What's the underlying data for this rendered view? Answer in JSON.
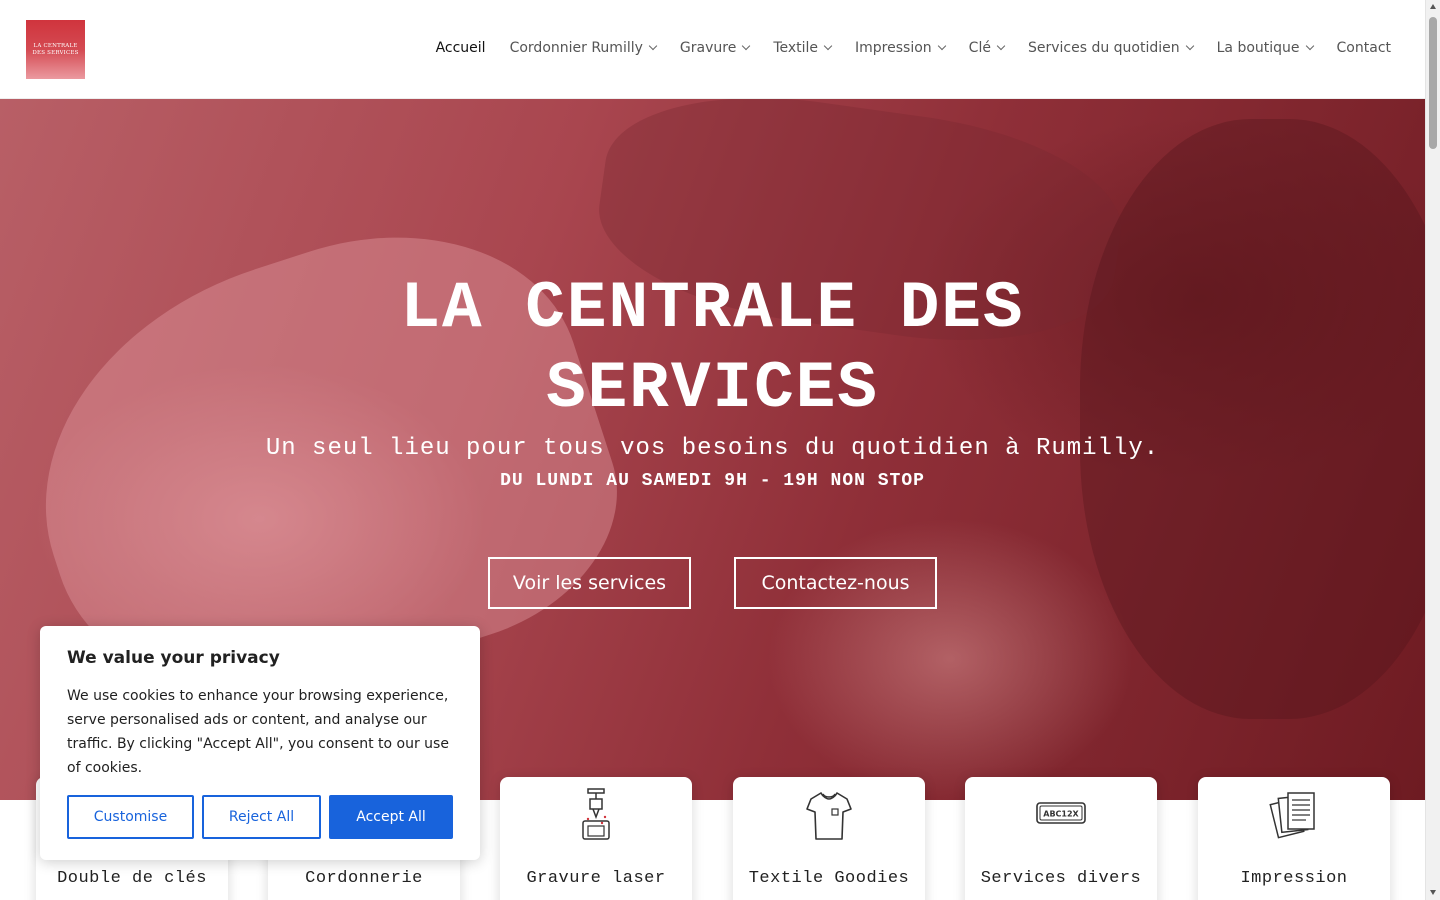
{
  "header": {
    "logo_line1": "LA CENTRALE",
    "logo_line2": "DES SERVICES",
    "nav": [
      {
        "label": "Accueil",
        "dropdown": false
      },
      {
        "label": "Cordonnier Rumilly",
        "dropdown": true
      },
      {
        "label": "Gravure",
        "dropdown": true
      },
      {
        "label": "Textile",
        "dropdown": true
      },
      {
        "label": "Impression",
        "dropdown": true
      },
      {
        "label": "Clé",
        "dropdown": true
      },
      {
        "label": "Services du quotidien",
        "dropdown": true
      },
      {
        "label": "La boutique",
        "dropdown": true
      },
      {
        "label": "Contact",
        "dropdown": false
      }
    ]
  },
  "hero": {
    "title_line1": "LA CENTRALE DES",
    "title_line2": "SERVICES",
    "subtitle": "Un seul lieu pour tous vos besoins du quotidien à Rumilly.",
    "hours": "DU LUNDI AU SAMEDI 9H - 19H NON STOP",
    "button_services": "Voir les services",
    "button_contact": "Contactez-nous"
  },
  "services": [
    {
      "label": "Double de clés",
      "icon": "key-icon"
    },
    {
      "label": "Cordonnerie",
      "icon": "shoe-icon"
    },
    {
      "label": "Gravure laser",
      "icon": "laser-engraver-icon"
    },
    {
      "label": "Textile Goodies",
      "icon": "tshirt-icon"
    },
    {
      "label": "Services divers",
      "icon": "license-plate-icon"
    },
    {
      "label": "Impression",
      "icon": "documents-icon"
    }
  ],
  "plate_text": "ABC12X",
  "cookie": {
    "title": "We value your privacy",
    "text": "We use cookies to enhance your browsing experience, serve personalised ads or content, and analyse our traffic. By clicking \"Accept All\", you consent to our use of cookies.",
    "customise": "Customise",
    "reject": "Reject All",
    "accept": "Accept All"
  },
  "colors": {
    "brand": "#d0343d",
    "cookie_accent": "#1863dc"
  }
}
